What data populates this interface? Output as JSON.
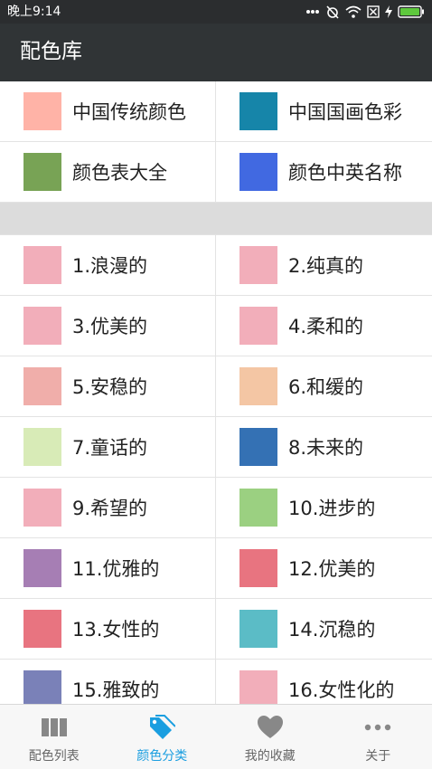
{
  "status": {
    "time": "晚上9:14"
  },
  "app": {
    "title": "配色库"
  },
  "top_grid": [
    {
      "label": "中国传统颜色",
      "color": "#ffb3a7"
    },
    {
      "label": "中国国画色彩",
      "color": "#1685a9"
    },
    {
      "label": "颜色表大全",
      "color": "#78a355"
    },
    {
      "label": "颜色中英名称",
      "color": "#4169e1"
    }
  ],
  "list_grid": [
    {
      "label": "1.浪漫的",
      "color": "#f2aeba"
    },
    {
      "label": "2.纯真的",
      "color": "#f2aeba"
    },
    {
      "label": "3.优美的",
      "color": "#f2aeba"
    },
    {
      "label": "4.柔和的",
      "color": "#f2aeba"
    },
    {
      "label": "5.安稳的",
      "color": "#f0aeaa"
    },
    {
      "label": "6.和缓的",
      "color": "#f4c6a4"
    },
    {
      "label": "7.童话的",
      "color": "#d8ebb7"
    },
    {
      "label": "8.未来的",
      "color": "#3471b4"
    },
    {
      "label": "9.希望的",
      "color": "#f2aeba"
    },
    {
      "label": "10.进步的",
      "color": "#9bd081"
    },
    {
      "label": "11.优雅的",
      "color": "#a67eb4"
    },
    {
      "label": "12.优美的",
      "color": "#e87480"
    },
    {
      "label": "13.女性的",
      "color": "#e87480"
    },
    {
      "label": "14.沉稳的",
      "color": "#5bbcc6"
    },
    {
      "label": "15.雅致的",
      "color": "#7a81b8"
    },
    {
      "label": "16.女性化的",
      "color": "#f2aeba"
    }
  ],
  "nav": [
    {
      "label": "配色列表",
      "icon": "columns-icon",
      "active": false
    },
    {
      "label": "颜色分类",
      "icon": "tag-icon",
      "active": true
    },
    {
      "label": "我的收藏",
      "icon": "heart-icon",
      "active": false
    },
    {
      "label": "关于",
      "icon": "more-dots-icon",
      "active": false
    }
  ],
  "colors": {
    "accent": "#1a9ee0",
    "appbar": "#303436",
    "statusbar": "#2b2d2f",
    "nav_inactive": "#888888"
  }
}
